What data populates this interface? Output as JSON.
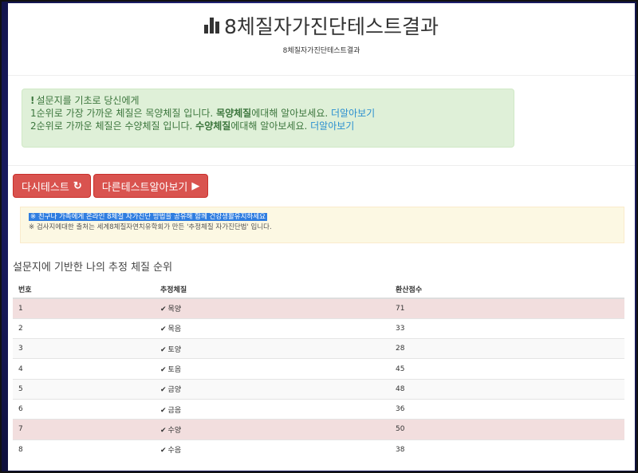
{
  "header": {
    "title": "8체질자가진단테스트결과",
    "subtitle": "8체질자가진단테스트결과"
  },
  "result_alert": {
    "intro": "설문지를 기초로 당신에게",
    "line1_pre": "1순위로 가장 가까운 체질은 목양체질 입니다. ",
    "line1_bold": "목양체질",
    "line1_post": "에대해 알아보세요. ",
    "line1_link": "더알아보기",
    "line2_pre": "2순위로 가까운 체질은 수양체질 입니다. ",
    "line2_bold": "수양체질",
    "line2_post": "에대해 알아보세요. ",
    "line2_link": "더알아보기"
  },
  "buttons": {
    "retest": "다시테스트",
    "retest_icon": "↻",
    "other_tests": "다른테스트알아보기",
    "other_icon": "▶"
  },
  "notice": {
    "line1": "※ 친구나 가족에게 온라인 8체질 자가진단 방법을 공유해 함께 건강생활유지하세요",
    "line2": "※ 검사지에대한 출처는 세계8체질자연치유학회가 만든 '추정체질 자가진단법' 입니다."
  },
  "ranking": {
    "title": "설문지에 기반한 나의 추정 체질 순위",
    "headers": [
      "번호",
      "추정체질",
      "환산점수"
    ],
    "rows": [
      {
        "no": "1",
        "type": "목양",
        "score": "71"
      },
      {
        "no": "2",
        "type": "목음",
        "score": "33"
      },
      {
        "no": "3",
        "type": "토양",
        "score": "28"
      },
      {
        "no": "4",
        "type": "토음",
        "score": "45"
      },
      {
        "no": "5",
        "type": "금양",
        "score": "48"
      },
      {
        "no": "6",
        "type": "금음",
        "score": "36"
      },
      {
        "no": "7",
        "type": "수양",
        "score": "50"
      },
      {
        "no": "8",
        "type": "수음",
        "score": "38"
      }
    ]
  },
  "colors": {
    "highlight_row": "#f2dede",
    "button": "#d9534f",
    "success_bg": "#dff0d8",
    "warning_bg": "#fcf8e3"
  }
}
